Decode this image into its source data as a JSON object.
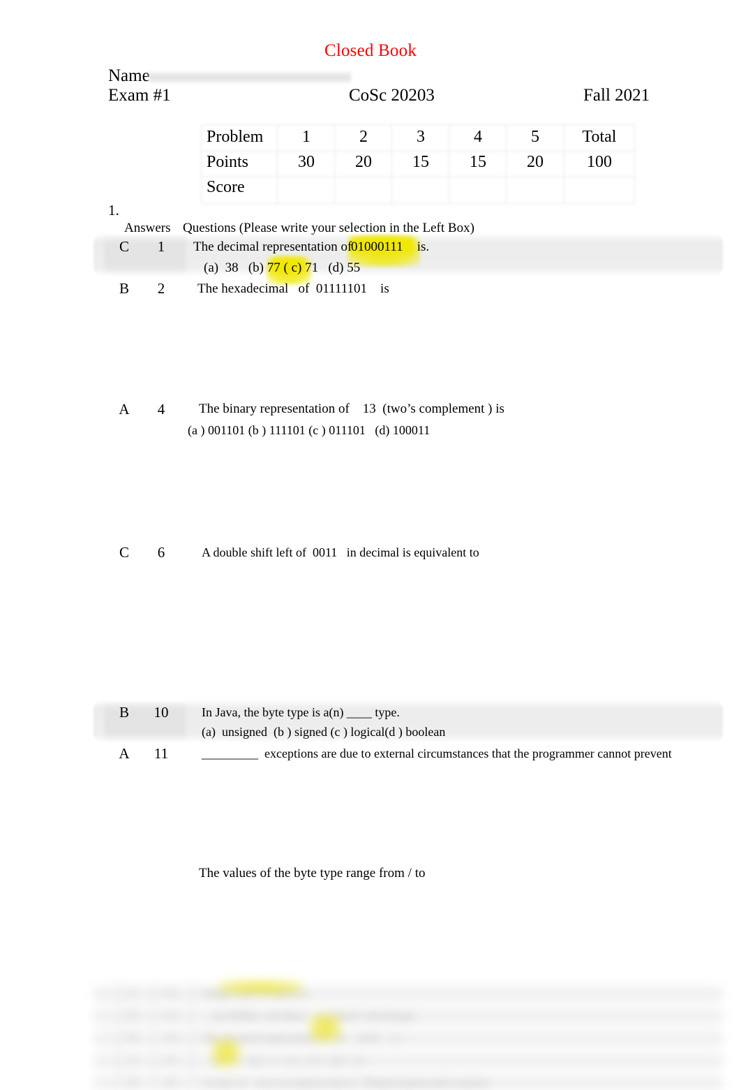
{
  "header": {
    "closed_book": "Closed Book",
    "name_label": "Name",
    "exam_label": "Exam #1",
    "course": "CoSc 20203",
    "term": "Fall 2021"
  },
  "score_table": {
    "rows": [
      {
        "label": "Problem",
        "cells": [
          "1",
          "2",
          "3",
          "4",
          "5",
          "Total"
        ]
      },
      {
        "label": "Points",
        "cells": [
          "30",
          "20",
          "15",
          "15",
          "20",
          "100"
        ]
      },
      {
        "label": "Score",
        "cells": [
          "",
          "",
          "",
          "",
          "",
          ""
        ]
      }
    ]
  },
  "section": {
    "number": "1.",
    "answers_header": "Answers",
    "questions_header": "Questions (Please write your selection in the Left Box)"
  },
  "questions": [
    {
      "answer": "C",
      "number": "1",
      "prompt_pre": "The decimal representation of  ",
      "prompt_hl": "01000111",
      "prompt_post": " is.",
      "choices": "(a)  38   (b) 77 ( c) 71   (d) 55"
    },
    {
      "answer": "B",
      "number": "2",
      "prompt": "The hexadecimal   of  01111101    is"
    },
    {
      "answer": "A",
      "number": "4",
      "prompt": "The binary representation of    13  (two’s complement ) is",
      "choices": "(a ) 001101 (b ) 111101 (c ) 011101   (d) 100011"
    },
    {
      "answer": "C",
      "number": "6",
      "prompt": "A double shift left of  0011   in decimal is equivalent to"
    },
    {
      "answer": "B",
      "number": "10",
      "prompt": "In Java, the byte type is a(n) ____ type.",
      "choices": "(a)  unsigned  (b ) signed (c ) logical(d ) boolean"
    },
    {
      "answer": "A",
      "number": "11",
      "prompt": "_________  exceptions are due to external circumstances that the programmer cannot prevent"
    }
  ],
  "trailing_text": "The values of the byte type range from / to",
  "colors": {
    "closed_book_red": "#ff0000",
    "highlight_yellow": "#f2e800",
    "row_shade_gray": "#e9e9e9",
    "grid_gray": "#d8d8d8",
    "page_background": "#ffffff"
  }
}
